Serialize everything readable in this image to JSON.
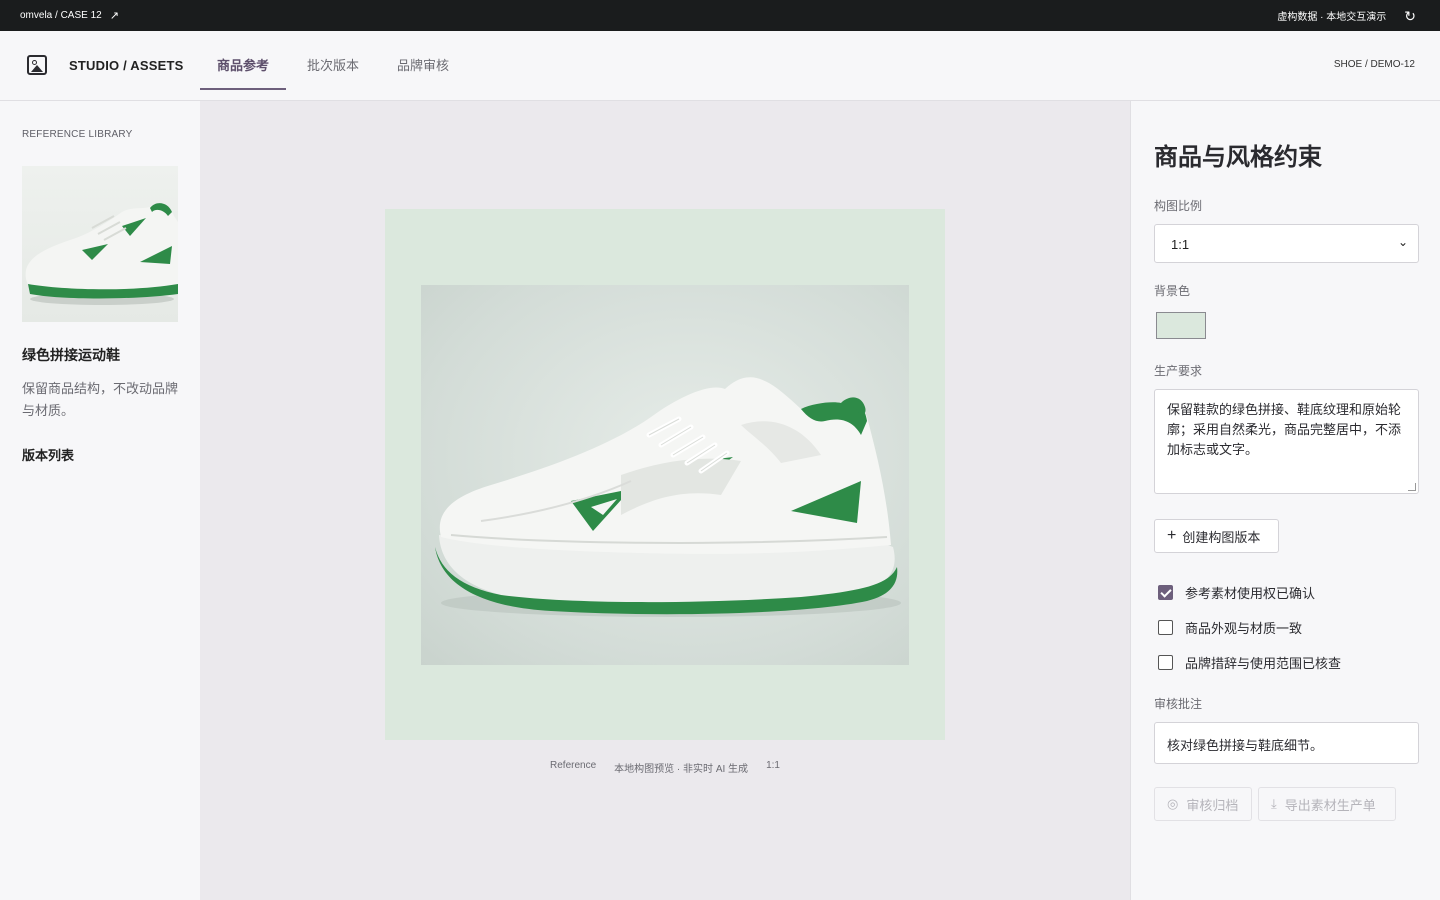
{
  "topbar": {
    "case_label": "omvela / CASE 12",
    "demo_note": "虚构数据 · 本地交互演示"
  },
  "header": {
    "brand": "STUDIO / ASSETS",
    "tabs": [
      {
        "label": "商品参考",
        "active": true
      },
      {
        "label": "批次版本",
        "active": false
      },
      {
        "label": "品牌审核",
        "active": false
      }
    ],
    "demo_id": "SHOE / DEMO-12"
  },
  "sidebar": {
    "library_title": "REFERENCE LIBRARY",
    "product_name": "绿色拼接运动鞋",
    "product_desc": "保留商品结构，不改动品牌与材质。",
    "version_list": "版本列表"
  },
  "canvas": {
    "caption": [
      "Reference",
      "本地构图预览 · 非实时 AI 生成",
      "1:1"
    ],
    "background_color": "#dbe8dd"
  },
  "panel": {
    "title": "商品与风格约束",
    "ratio_label": "构图比例",
    "ratio_value": "1:1",
    "bg_label": "背景色",
    "bg_color": "#dbe8dd",
    "req_label": "生产要求",
    "req_text": "保留鞋款的绿色拼接、鞋底纹理和原始轮廓；采用自然柔光，商品完整居中，不添加标志或文字。",
    "create_button": "创建构图版本",
    "checks": [
      {
        "label": "参考素材使用权已确认",
        "checked": true
      },
      {
        "label": "商品外观与材质一致",
        "checked": false
      },
      {
        "label": "品牌措辞与使用范围已核查",
        "checked": false
      }
    ],
    "note_label": "审核批注",
    "note_text": "核对绿色拼接与鞋底细节。",
    "archive_button": "审核归档",
    "export_button": "导出素材生产单"
  },
  "colors": {
    "accent": "#6d5f7c",
    "topbar": "#1a1c1d",
    "shoe_green": "#2e8b48"
  }
}
